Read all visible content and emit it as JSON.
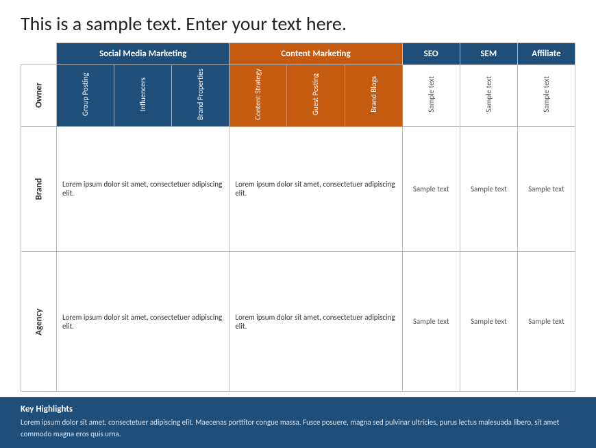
{
  "title": "This is a sample text. Enter your text here.",
  "table": {
    "col_groups": [
      {
        "label": "Social Media Marketing",
        "color": "blue",
        "span": 3
      },
      {
        "label": "Content Marketing",
        "color": "orange",
        "span": 3
      },
      {
        "label": "SEO",
        "color": "blue",
        "span": 1
      },
      {
        "label": "SEM",
        "color": "blue",
        "span": 1
      },
      {
        "label": "Affiliate",
        "color": "blue",
        "span": 1
      }
    ],
    "sub_cols": [
      {
        "label": "Group Posting",
        "color": "blue"
      },
      {
        "label": "Influencers",
        "color": "blue"
      },
      {
        "label": "Brand Properties",
        "color": "blue"
      },
      {
        "label": "Content Strategy",
        "color": "orange"
      },
      {
        "label": "Guest Posting",
        "color": "orange"
      },
      {
        "label": "Brand Blogs",
        "color": "orange"
      },
      {
        "label": "Sample text",
        "color": "none"
      },
      {
        "label": "Sample text",
        "color": "none"
      },
      {
        "label": "Sample text",
        "color": "none"
      }
    ],
    "rows": [
      {
        "row_label": "Owner",
        "type": "subheader"
      },
      {
        "row_label": "Brand",
        "type": "data",
        "cells": [
          {
            "text": "Lorem ipsum dolor sit amet, consectetuer adipiscing elit.",
            "span": 3
          },
          {
            "text": "Lorem ipsum dolor sit amet, consectetuer adipiscing elit.",
            "span": 3
          },
          {
            "text": "Sample text"
          },
          {
            "text": "Sample text"
          },
          {
            "text": "Sample text"
          }
        ]
      },
      {
        "row_label": "Agency",
        "type": "data",
        "cells": [
          {
            "text": "Lorem ipsum dolor sit amet, consectetuer adipiscing elit.",
            "span": 3
          },
          {
            "text": "Lorem ipsum dolor sit amet, consectetuer adipiscing elit.",
            "span": 3
          },
          {
            "text": "Sample text"
          },
          {
            "text": "Sample text"
          },
          {
            "text": "Sample text"
          }
        ]
      }
    ]
  },
  "key_highlights": {
    "title": "Key Highlights",
    "text": "Lorem ipsum dolor sit amet, consectetuer adipiscing elit. Maecenas porttitor congue massa. Fusce posuere, magna sed pulvinar ultricies, purus lectus malesuada libero, sit amet commodo magna eros quis urna."
  }
}
